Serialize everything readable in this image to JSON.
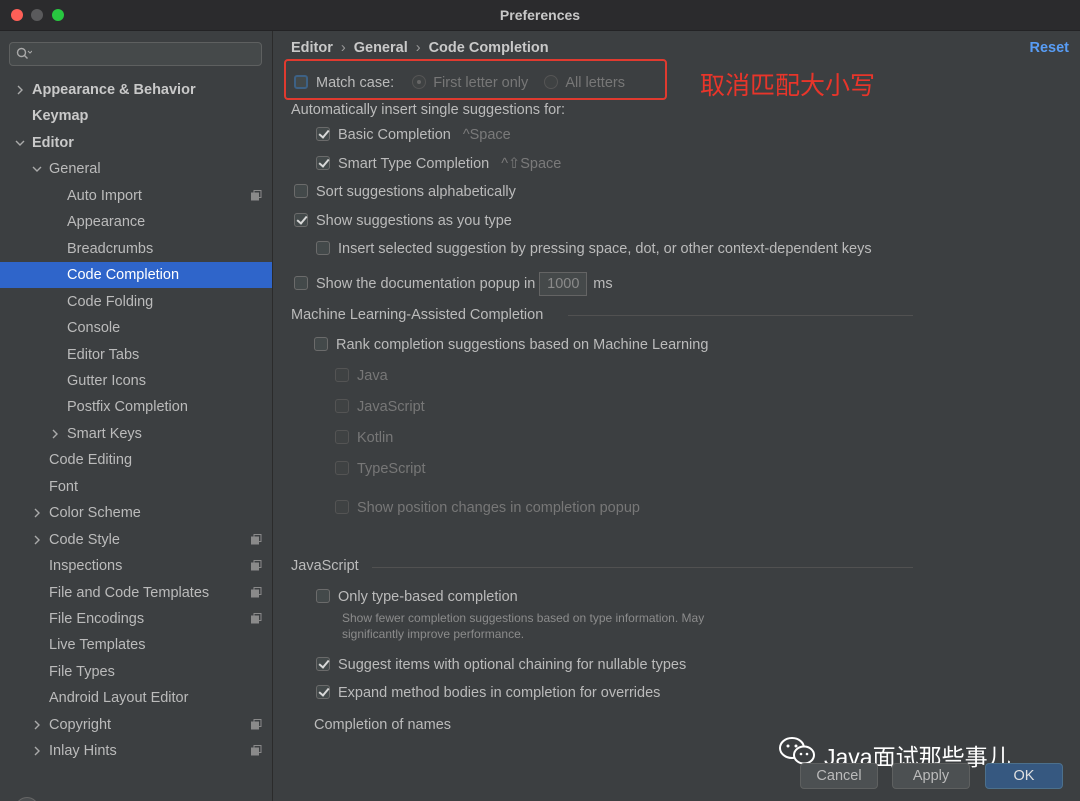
{
  "window": {
    "title": "Preferences"
  },
  "search": {
    "placeholder": ""
  },
  "sidebar": {
    "items": [
      {
        "label": "Appearance & Behavior",
        "chevron": "right",
        "bold": true
      },
      {
        "label": "Keymap",
        "bold": true
      },
      {
        "label": "Editor",
        "chevron": "down",
        "bold": true
      },
      {
        "label": "General",
        "chevron": "down"
      },
      {
        "label": "Auto Import",
        "copy_icon": true
      },
      {
        "label": "Appearance"
      },
      {
        "label": "Breadcrumbs"
      },
      {
        "label": "Code Completion",
        "selected": true
      },
      {
        "label": "Code Folding"
      },
      {
        "label": "Console"
      },
      {
        "label": "Editor Tabs"
      },
      {
        "label": "Gutter Icons"
      },
      {
        "label": "Postfix Completion"
      },
      {
        "label": "Smart Keys",
        "chevron": "right"
      },
      {
        "label": "Code Editing"
      },
      {
        "label": "Font"
      },
      {
        "label": "Color Scheme",
        "chevron": "right"
      },
      {
        "label": "Code Style",
        "chevron": "right",
        "copy_icon": true
      },
      {
        "label": "Inspections",
        "copy_icon": true
      },
      {
        "label": "File and Code Templates",
        "copy_icon": true
      },
      {
        "label": "File Encodings",
        "copy_icon": true
      },
      {
        "label": "Live Templates"
      },
      {
        "label": "File Types"
      },
      {
        "label": "Android Layout Editor"
      },
      {
        "label": "Copyright",
        "chevron": "right",
        "copy_icon": true
      },
      {
        "label": "Inlay Hints",
        "chevron": "right",
        "copy_icon": true
      }
    ],
    "help": "?"
  },
  "breadcrumb": {
    "editor": "Editor",
    "general": "General",
    "current": "Code Completion"
  },
  "reset": "Reset",
  "match_case": {
    "label": "Match case:",
    "checked": false,
    "option_first": "First letter only",
    "option_all": "All letters"
  },
  "auto_insert": {
    "title": "Automatically insert single suggestions for:",
    "basic": {
      "label": "Basic Completion",
      "shortcut": "^Space",
      "checked": true
    },
    "smart": {
      "label": "Smart Type Completion",
      "shortcut": "^⇧Space",
      "checked": true
    }
  },
  "sort_alpha": {
    "label": "Sort suggestions alphabetically",
    "checked": false
  },
  "show_as_type": {
    "label": "Show suggestions as you type",
    "checked": true
  },
  "insert_selected": {
    "label": "Insert selected suggestion by pressing space, dot, or other context-dependent keys",
    "checked": false
  },
  "doc_popup": {
    "label": "Show the documentation popup in",
    "value": "1000",
    "unit": "ms",
    "checked": false
  },
  "ml": {
    "title": "Machine Learning-Assisted Completion",
    "rank": "Rank completion suggestions based on Machine Learning",
    "java": "Java",
    "javascript": "JavaScript",
    "kotlin": "Kotlin",
    "typescript": "TypeScript",
    "position": "Show position changes in completion popup"
  },
  "js": {
    "title": "JavaScript",
    "only_type": "Only type-based completion",
    "hint1": "Show fewer completion suggestions based on type information. May",
    "hint2": "significantly improve performance.",
    "optional_chaining": "Suggest items with optional chaining for nullable types",
    "expand_method": "Expand method bodies in completion for overrides",
    "completion_names": "Completion of names"
  },
  "annotation": "取消匹配大小写",
  "watermark": "Java面试那些事儿",
  "buttons": {
    "cancel": "Cancel",
    "apply": "Apply",
    "ok": "OK"
  },
  "colors": {
    "accent": "#2f65ca",
    "link": "#589df6",
    "annotation": "#e03a2f"
  }
}
